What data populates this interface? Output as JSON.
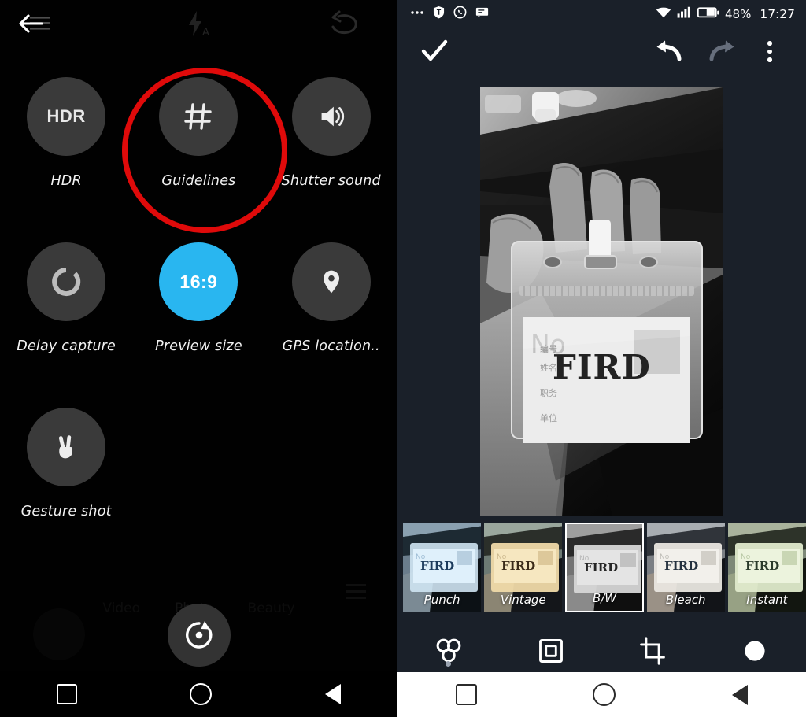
{
  "left_panel": {
    "name": "camera-settings-overlay",
    "topbar": {
      "back_icon": "back-arrow-icon",
      "menu_icon": "hamburger-menu-icon",
      "flash_icon": "flash-auto-icon",
      "switch_camera_icon": "switch-camera-icon"
    },
    "settings": [
      {
        "icon": "hdr-icon",
        "icon_text": "HDR",
        "label": "HDR",
        "active": false
      },
      {
        "icon": "grid-guidelines-icon",
        "icon_text": "",
        "label": "Guidelines",
        "active": false,
        "highlighted": true
      },
      {
        "icon": "speaker-icon",
        "icon_text": "",
        "label": "Shutter sound",
        "active": false
      },
      {
        "icon": "timer-icon",
        "icon_text": "",
        "label": "Delay capture",
        "active": false
      },
      {
        "icon": "aspect-ratio-icon",
        "icon_text": "16:9",
        "label": "Preview size",
        "active": true
      },
      {
        "icon": "location-pin-icon",
        "icon_text": "",
        "label": "GPS location..",
        "active": false
      },
      {
        "icon": "peace-hand-icon",
        "icon_text": "",
        "label": "Gesture shot",
        "active": false
      }
    ],
    "modes": [
      {
        "label": "Video",
        "selected": false
      },
      {
        "label": "Photo",
        "selected": true
      },
      {
        "label": "Beauty",
        "selected": false
      }
    ],
    "shutter_icon": "shutter-button-icon",
    "gallery_icon": "gallery-thumbnail-icon",
    "annotation": {
      "shape": "circle",
      "color": "#df0a0a",
      "targets": "Guidelines"
    },
    "navbar": {
      "recents": "square-icon",
      "home": "circle-icon",
      "back": "triangle-back-icon"
    }
  },
  "right_panel": {
    "name": "photo-editor",
    "statusbar": {
      "left_icons": [
        "more-notifications-icon",
        "shield-icon",
        "whatsapp-icon",
        "message-icon"
      ],
      "wifi_icon": "wifi-icon",
      "signal_icon": "signal-bars-icon",
      "battery_icon": "battery-icon",
      "battery_percent": "48%",
      "time": "17:27"
    },
    "toolbar": {
      "confirm_label": "check-icon",
      "undo_label": "undo-icon",
      "redo_label": "redo-icon",
      "more_label": "overflow-menu-icon",
      "redo_disabled": true
    },
    "photo": {
      "alt": "Black and white photo of a hand holding a clear ID badge holder with a card reading FIRD",
      "badge_text": "FIRD",
      "badge_no_label": "No",
      "filter_applied": "B/W"
    },
    "filters": [
      {
        "label": "Punch",
        "selected": false,
        "tint": "#cfe4f2"
      },
      {
        "label": "Vintage",
        "selected": false,
        "tint": "#efd9a8"
      },
      {
        "label": "B/W",
        "selected": true,
        "tint": "#d6d6d6"
      },
      {
        "label": "Bleach",
        "selected": false,
        "tint": "#e9e6df"
      },
      {
        "label": "Instant",
        "selected": false,
        "tint": "#dfeacb"
      }
    ],
    "tools": [
      {
        "icon": "filters-icon",
        "name": "filters",
        "selected": true
      },
      {
        "icon": "frame-icon",
        "name": "frame",
        "selected": false
      },
      {
        "icon": "crop-icon",
        "name": "crop",
        "selected": false
      },
      {
        "icon": "adjust-icon",
        "name": "adjust",
        "selected": false
      }
    ],
    "navbar": {
      "recents": "square-icon",
      "home": "circle-icon",
      "back": "triangle-back-icon"
    }
  },
  "colors": {
    "camera_bg": "#010101",
    "editor_bg": "#1a2029",
    "accent_blue": "#29b6f0",
    "annotation_red": "#df0a0a",
    "circle_gray": "#3a3a3a"
  }
}
